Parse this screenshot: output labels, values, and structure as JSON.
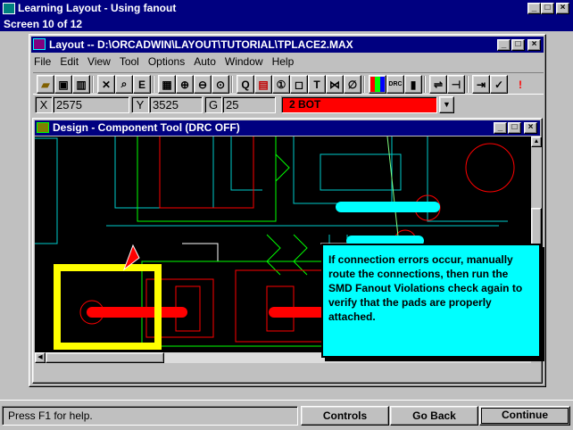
{
  "app": {
    "title": "Learning Layout - Using fanout",
    "screen_label": "Screen 10 of 12"
  },
  "layout_window": {
    "title": "Layout -- D:\\ORCADWIN\\LAYOUT\\TUTORIAL\\TPLACE2.MAX",
    "menu": [
      "File",
      "Edit",
      "View",
      "Tool",
      "Options",
      "Auto",
      "Window",
      "Help"
    ],
    "coords": {
      "x_label": "X",
      "x_value": "2575",
      "y_label": "Y",
      "y_value": "3525",
      "g_label": "G",
      "g_value": "25",
      "layer": "2 BOT"
    },
    "toolbar_icons": [
      "open-icon",
      "save-icon",
      "library-icon",
      "delete-icon",
      "search-icon",
      "text-e-icon",
      "grid-icon",
      "zoom-in-icon",
      "zoom-out-icon",
      "zoom-all-icon",
      "query-icon",
      "component-icon",
      "pin-icon",
      "obstacle-icon",
      "text-icon",
      "connection-icon",
      "error-icon",
      "color-icon",
      "drc-icon",
      "pin-list-icon",
      "route-icon",
      "fanout-icon",
      "autoroute-icon",
      "check-icon",
      "alert-icon"
    ]
  },
  "design_window": {
    "title": "Design - Component Tool (DRC OFF)",
    "tooltip": "If connection errors occur, manually route the connections, then run the SMD Fanout Violations check again to verify that the pads are properly attached."
  },
  "status": {
    "help_text": "Press F1 for help.",
    "buttons": {
      "controls": "Controls",
      "go_back": "Go Back",
      "continue": "Continue"
    }
  },
  "colors": {
    "title_active": "#000080",
    "design_bg": "#000000",
    "layer_bg": "#ff0000",
    "tooltip_bg": "#00ffff",
    "highlight": "#ffff00"
  }
}
